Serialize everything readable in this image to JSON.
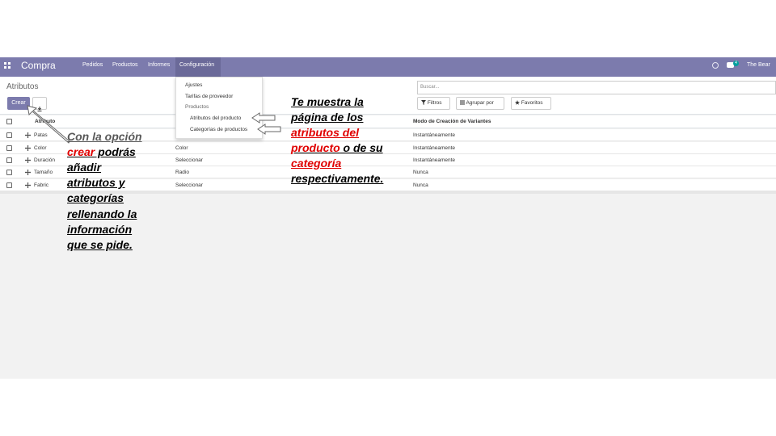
{
  "navbar": {
    "brand": "Compra",
    "menu": [
      "Pedidos",
      "Productos",
      "Informes",
      "Configuración"
    ],
    "chat_count": "4",
    "user": "The Bear"
  },
  "control": {
    "title": "Atributos",
    "create_label": "Crear",
    "search_placeholder": "Buscar...",
    "filters_label": "Filtros",
    "group_label": "Agrupar por",
    "favorites_label": "Favoritos"
  },
  "dropdown": {
    "items": [
      "Ajustes",
      "Tarifas de proveedor",
      "Productos",
      "Atributos del producto",
      "Categorías de productos"
    ]
  },
  "table": {
    "columns": [
      "Atributo",
      "Modo de Creación de Variantes"
    ],
    "rows": [
      {
        "name": "Patas",
        "display": "",
        "mode": "Instantáneamente"
      },
      {
        "name": "Color",
        "display": "Color",
        "mode": "Instantáneamente"
      },
      {
        "name": "Duración",
        "display": "Seleccionar",
        "mode": "Instantáneamente"
      },
      {
        "name": "Tamaño",
        "display": "Radio",
        "mode": "Nunca"
      },
      {
        "name": "Fabric",
        "display": "Seleccionar",
        "mode": "Nunca"
      }
    ]
  },
  "annotations": {
    "left": {
      "l1": "Con la opción",
      "l2a": "crear",
      "l2b": " podrás",
      "l3": "añadir",
      "l4": "atributos y",
      "l5": "categorías",
      "l6": "rellenando la",
      "l7": "información",
      "l8": "que se pide."
    },
    "right": {
      "l1": "Te muestra la",
      "l2": "página de los",
      "l3": "atributos del",
      "l4a": "producto",
      "l4b": "  o de su",
      "l5": "categoría",
      "l6": "respectivamente."
    }
  },
  "colors": {
    "navbar": "#7c7bad",
    "accent_red": "#e00000",
    "badge": "#00a09d"
  }
}
